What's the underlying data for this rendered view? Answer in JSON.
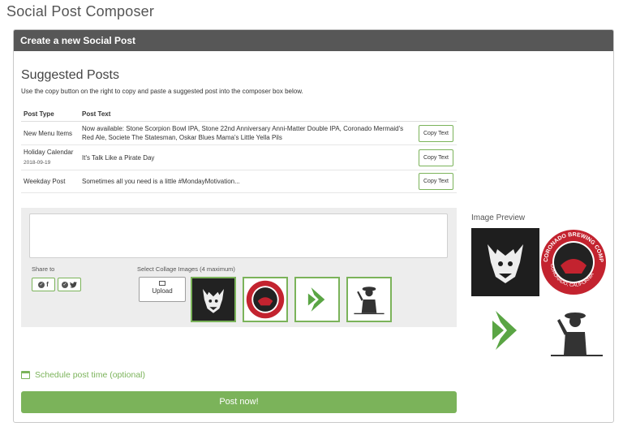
{
  "page": {
    "title": "Social Post Composer"
  },
  "panel": {
    "header": "Create a new Social Post"
  },
  "suggested": {
    "title": "Suggested Posts",
    "help": "Use the copy button on the right to copy and paste a suggested post into the composer box below.",
    "columns": {
      "type": "Post Type",
      "text": "Post Text"
    },
    "rows": [
      {
        "type": "New Menu Items",
        "date": "",
        "text": "Now available: Stone Scorpion Bowl IPA, Stone 22nd Anniversary Anni-Matter Double IPA, Coronado Mermaid's Red Ale, Societe The Statesman, Oskar Blues Mama's Little Yella Pils",
        "button": "Copy Text"
      },
      {
        "type": "Holiday Calendar",
        "date": "2018-09-19",
        "text": "It's Talk Like a Pirate Day",
        "button": "Copy Text"
      },
      {
        "type": "Weekday Post",
        "date": "",
        "text": "Sometimes all you need is a little #MondayMotivation...",
        "button": "Copy Text"
      }
    ]
  },
  "composer": {
    "text_value": "",
    "share_label": "Share to",
    "share_networks": [
      "f",
      "twitter"
    ],
    "collage_label": "Select Collage Images (4 maximum)",
    "upload_label": "Upload",
    "images": [
      {
        "name": "stone-gargoyle",
        "selected": true
      },
      {
        "name": "coronado-brewing",
        "selected": true
      },
      {
        "name": "green-arrow-logo",
        "selected": false
      },
      {
        "name": "oskar-silhouette",
        "selected": false
      }
    ]
  },
  "preview": {
    "label": "Image Preview",
    "badge_text": "CORONADO BREWING COMPANY",
    "badge_sub": "CORONADO, CALIFORNIA"
  },
  "schedule": {
    "label": "Schedule post time (optional)"
  },
  "actions": {
    "post_now": "Post now!"
  },
  "colors": {
    "accent": "#7bb35a",
    "header": "#575757",
    "composer_bg": "#ededed"
  }
}
